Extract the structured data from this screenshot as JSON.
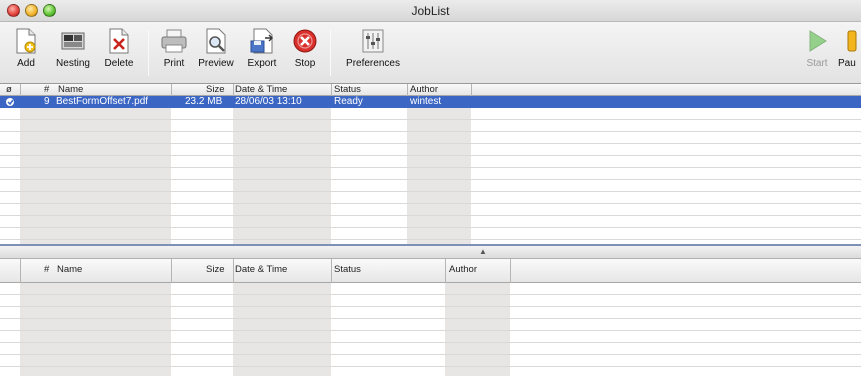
{
  "window": {
    "title": "JobList"
  },
  "toolbar": {
    "add": "Add",
    "nesting": "Nesting",
    "delete": "Delete",
    "print": "Print",
    "preview": "Preview",
    "export": "Export",
    "stop": "Stop",
    "preferences": "Preferences",
    "start": "Start",
    "pause": "Pau"
  },
  "top_table": {
    "headers": {
      "icon": "ø",
      "num": "#",
      "name": "Name",
      "size": "Size",
      "date": "Date & Time",
      "status": "Status",
      "author": "Author"
    },
    "rows": [
      {
        "num": "9",
        "name": "BestFormOffset7.pdf",
        "size": "23.2 MB",
        "date": "28/06/03 13:10",
        "status": "Ready",
        "author": "wintest"
      }
    ]
  },
  "bottom_table": {
    "headers": {
      "num": "#",
      "name": "Name",
      "size": "Size",
      "date": "Date & Time",
      "status": "Status",
      "author": "Author"
    }
  },
  "colors": {
    "selection": "#3b66c4",
    "stop": "#d9302c",
    "start": "#4cb93a",
    "column_shade": "#e8e6e4"
  }
}
